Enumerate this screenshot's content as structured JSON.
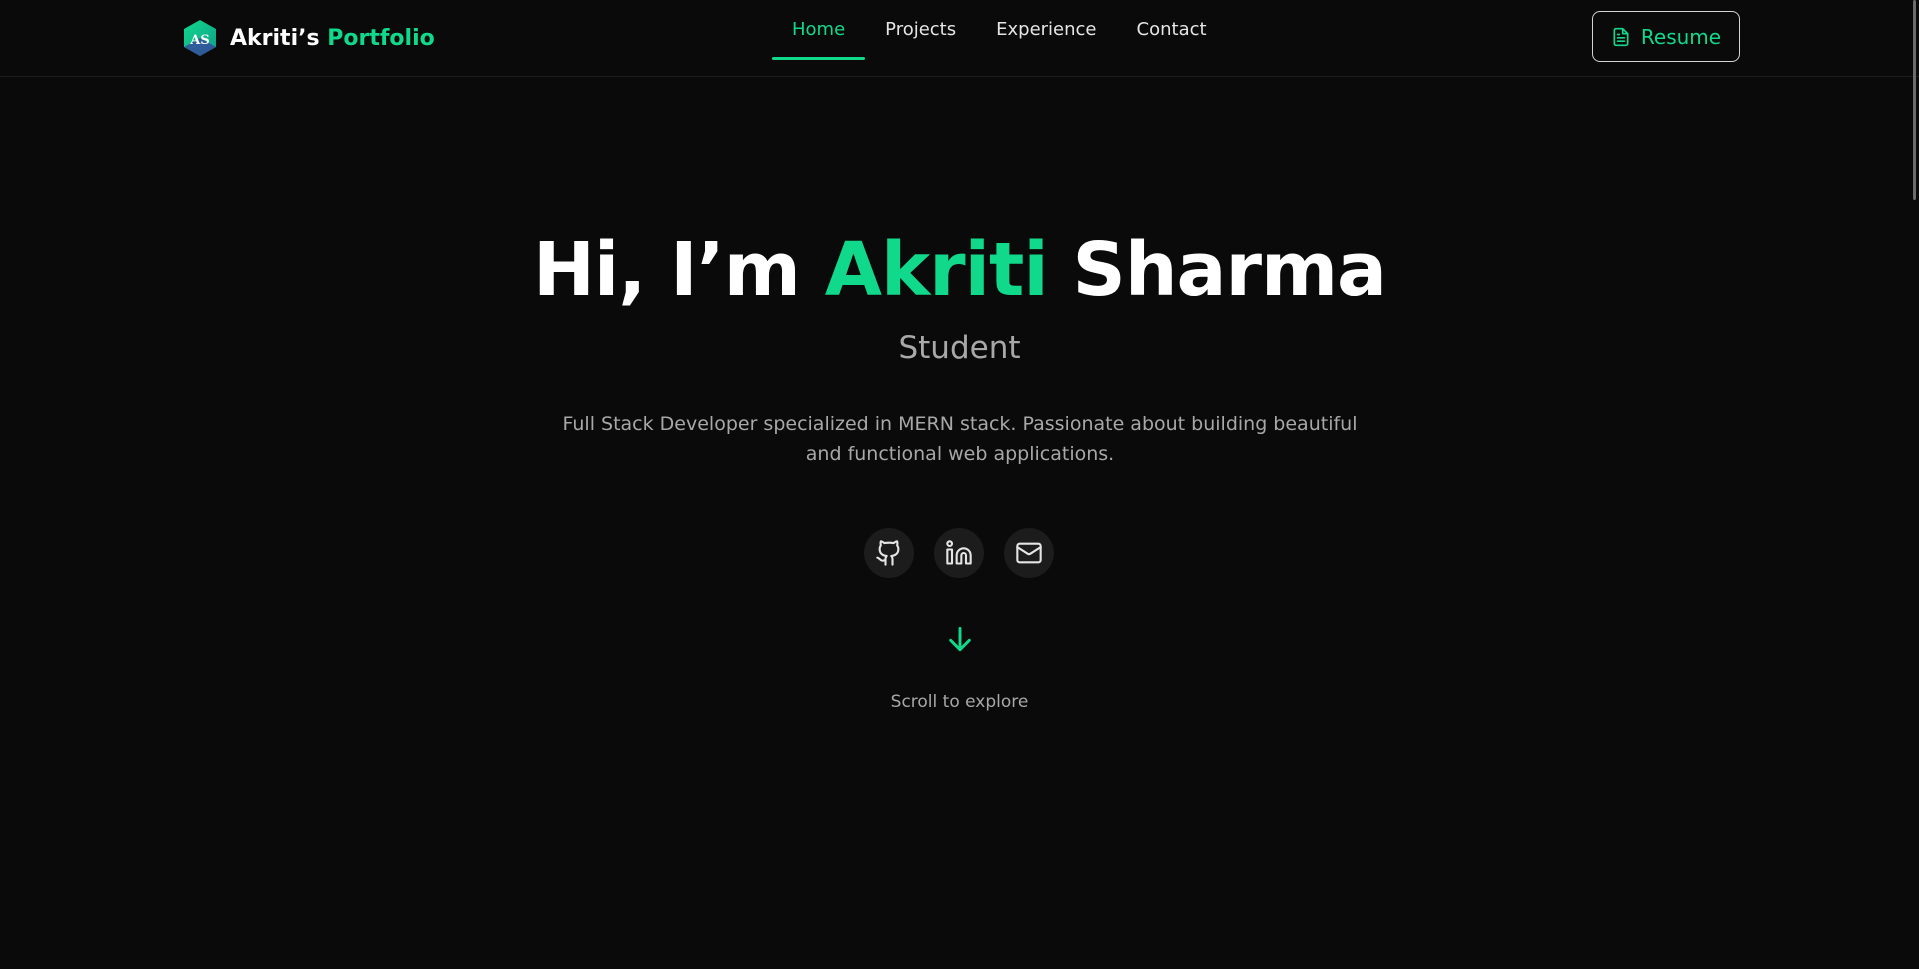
{
  "nav": {
    "logo": {
      "badge_text": "AS",
      "name": "Akriti’s",
      "accent": "Portfolio"
    },
    "links": [
      {
        "label": "Home",
        "active": true
      },
      {
        "label": "Projects",
        "active": false
      },
      {
        "label": "Experience",
        "active": false
      },
      {
        "label": "Contact",
        "active": false
      }
    ],
    "resume": {
      "label": "Resume",
      "icon": "file-text-icon"
    }
  },
  "hero": {
    "title_prefix": "Hi, I’m",
    "title_highlight": "Akriti",
    "title_suffix": "Sharma",
    "role": "Student",
    "description": "Full Stack Developer specialized in MERN stack. Passionate about building beautiful and functional web applications.",
    "socials": [
      {
        "icon": "github-icon"
      },
      {
        "icon": "linkedin-icon"
      },
      {
        "icon": "mail-icon"
      }
    ],
    "scroll_icon": "arrow-down-icon",
    "scroll_text": "Scroll to explore"
  },
  "colors": {
    "background": "#0a0a0a",
    "accent": "#10d98b",
    "muted_text": "#a8a8a8",
    "icon_circle": "#1c1c1c"
  }
}
